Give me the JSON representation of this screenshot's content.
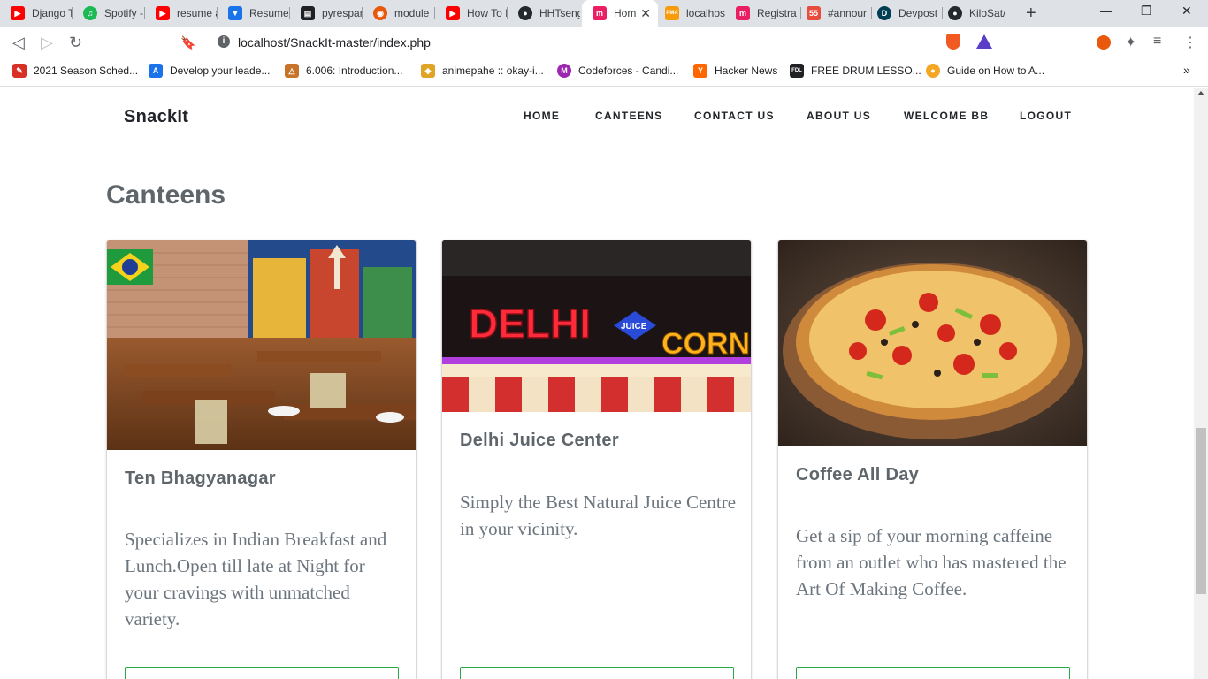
{
  "browser": {
    "tabs": [
      {
        "title": "Django T",
        "color": "#ff0000",
        "glyph": "▶"
      },
      {
        "title": "Spotify -",
        "color": "#1db954",
        "glyph": "♫"
      },
      {
        "title": "resume a",
        "color": "#ff0000",
        "glyph": "▶"
      },
      {
        "title": "Resume",
        "color": "#1a73e8",
        "glyph": "▼"
      },
      {
        "title": "pyrespar",
        "color": "#202124",
        "glyph": "▤"
      },
      {
        "title": "module",
        "color": "#e8590c",
        "glyph": "◉"
      },
      {
        "title": "How To I",
        "color": "#ff0000",
        "glyph": "▶"
      },
      {
        "title": "HHTseng",
        "color": "#24292e",
        "glyph": "●"
      },
      {
        "title": "Hom",
        "color": "#e91e63",
        "glyph": "m"
      },
      {
        "title": "localhos",
        "color": "#f89c0e",
        "glyph": "PMA"
      },
      {
        "title": "Registra",
        "color": "#e91e63",
        "glyph": "m"
      },
      {
        "title": "#annour",
        "color": "#e74c3c",
        "glyph": "55"
      },
      {
        "title": "Devpost",
        "color": "#003e54",
        "glyph": "D"
      },
      {
        "title": "KiloSat/",
        "color": "#24292e",
        "glyph": "●"
      }
    ],
    "active_tab_close": "✕",
    "new_tab": "+",
    "window_controls": {
      "minimize": "—",
      "maximize": "❐",
      "close": "✕"
    },
    "nav": {
      "back": "◁",
      "forward": "▷",
      "reload": "↻",
      "bookmark": "🔖"
    },
    "url": "localhost/SnackIt-master/index.php",
    "info_icon": "i",
    "toolbar_icons": {
      "extensions": "✦",
      "media": "≡",
      "menu": "⋮"
    },
    "bookmarks": [
      {
        "label": "2021 Season Sched...",
        "color": "#d93025",
        "glyph": "✎"
      },
      {
        "label": "Develop your leade...",
        "color": "#1a73e8",
        "glyph": "A"
      },
      {
        "label": "6.006: Introduction...",
        "color": "#c7732a",
        "glyph": "△"
      },
      {
        "label": "animepahe :: okay-i...",
        "color": "#e0a526",
        "glyph": "◆"
      },
      {
        "label": "Codeforces - Candi...",
        "color": "#9c27b0",
        "glyph": "M"
      },
      {
        "label": "Hacker News",
        "color": "#ff6600",
        "glyph": "Y"
      },
      {
        "label": "FREE DRUM LESSO...",
        "color": "#202124",
        "glyph": "FDL"
      },
      {
        "label": "Guide on How to A...",
        "color": "#f5a623",
        "glyph": "●"
      }
    ],
    "bookmarks_more": "»"
  },
  "site": {
    "brand": "SnackIt",
    "nav": {
      "home": "HOME",
      "canteens": "CANTEENS",
      "contact": "CONTACT US",
      "about": "ABOUT US",
      "welcome": "WELCOME BB",
      "logout": "LOGOUT"
    },
    "section_title": "Canteens",
    "cards": [
      {
        "name": "Ten Bhagyanagar",
        "description": "Specializes in Indian Breakfast and Lunch.Open till late at Night for your cravings with unmatched variety."
      },
      {
        "name": "Delhi Juice Center",
        "description": "Simply the Best Natural Juice Centre in your vicinity.",
        "sign": {
          "left": "DELHI",
          "badge": "JUICE",
          "right": "CORNER"
        }
      },
      {
        "name": "Coffee All Day",
        "description": "Get a sip of your morning caffeine from an outlet who has mastered the Art Of Making Coffee."
      }
    ]
  }
}
